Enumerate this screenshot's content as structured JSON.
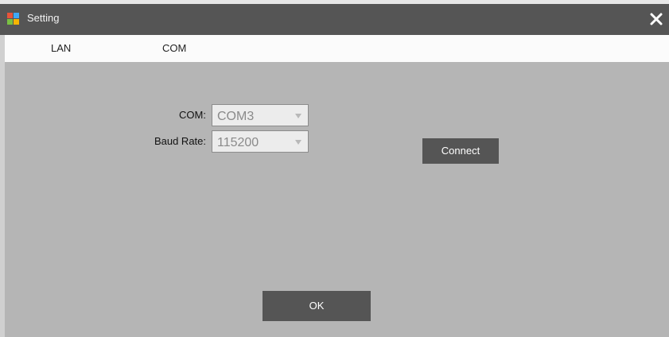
{
  "window": {
    "title": "Setting",
    "icon": "app-icon",
    "close_icon": "close-icon"
  },
  "tabs": [
    {
      "label": "LAN"
    },
    {
      "label": "COM"
    }
  ],
  "form": {
    "com_label": "COM:",
    "com_value": "COM3",
    "baud_label": "Baud Rate:",
    "baud_value": "115200"
  },
  "buttons": {
    "connect": "Connect",
    "ok": "OK"
  },
  "colors": {
    "title_bar": "#555555",
    "background": "#b5b5b5",
    "tab_bar": "#fbfbfb",
    "button": "#555555"
  }
}
